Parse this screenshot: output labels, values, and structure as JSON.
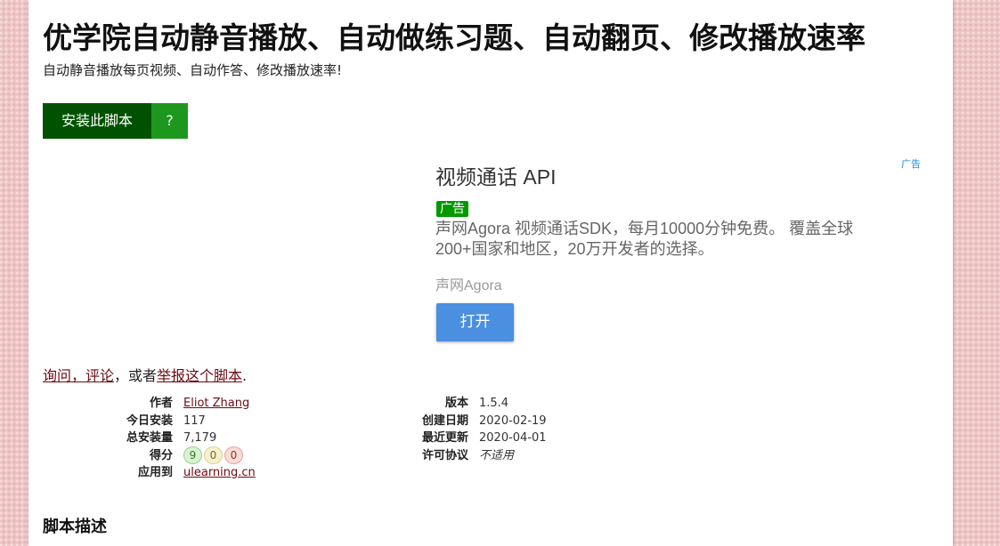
{
  "script": {
    "title": "优学院自动静音播放、自动做练习题、自动翻页、修改播放速率",
    "subtitle": "自动静音播放每页视频、自动作答、修改播放速率!",
    "install_label": "安装此脚本",
    "help_label": "?"
  },
  "ad": {
    "mark": "广告",
    "title": "视频通话 API",
    "badge": "广告",
    "description": "声网Agora 视频通话SDK，每月10000分钟免费。 覆盖全球200+国家和地区，20万开发者的选择。",
    "source": "声网Agora",
    "open_label": "打开"
  },
  "feedback": {
    "link_ask": "询问，评论",
    "middle": "，或者",
    "link_report": "举报这个脚本",
    "end": "."
  },
  "meta_left": {
    "author_label": "作者",
    "author": "Eliot Zhang",
    "today_label": "今日安装",
    "today": "117",
    "total_label": "总安装量",
    "total": "7,179",
    "score_label": "得分",
    "score_good": "9",
    "score_ok": "0",
    "score_bad": "0",
    "applies_label": "应用到",
    "applies": "ulearning.cn"
  },
  "meta_right": {
    "version_label": "版本",
    "version": "1.5.4",
    "created_label": "创建日期",
    "created": "2020-02-19",
    "updated_label": "最近更新",
    "updated": "2020-04-01",
    "license_label": "许可协议",
    "license": "不适用"
  },
  "description_heading": "脚本描述",
  "colors": {
    "install_bg": "#005200",
    "help_bg": "#1e971e",
    "ad_button": "#4a8fe0",
    "link": "#6a0a12",
    "page_bg": "#efc6c6"
  }
}
